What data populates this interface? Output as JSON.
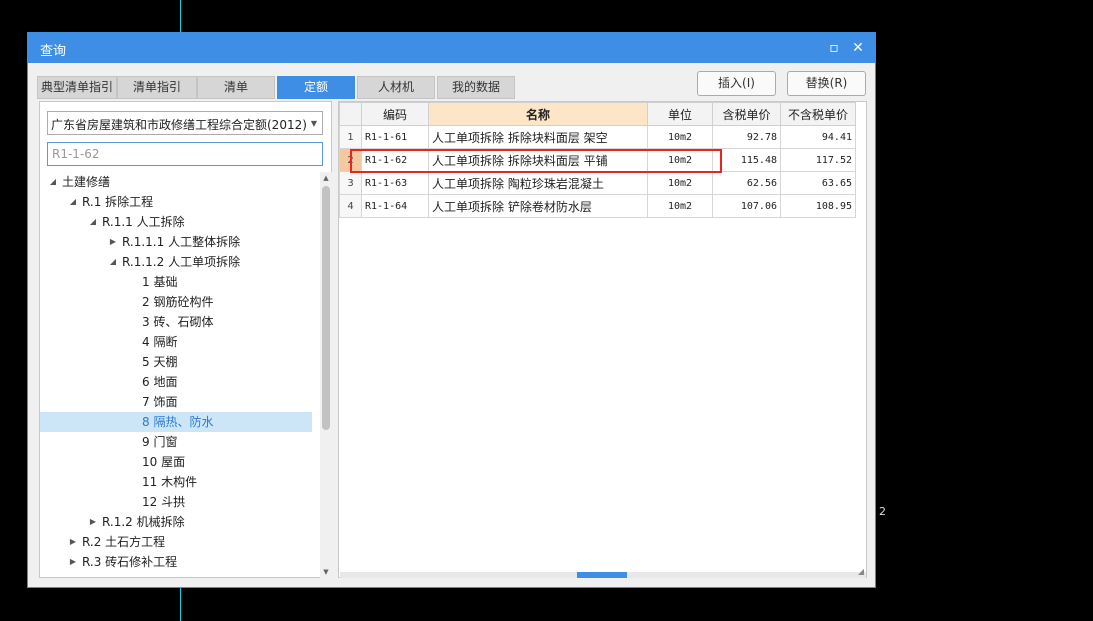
{
  "window": {
    "title": "查询",
    "maximize_icon": "maximize-icon",
    "close_icon": "close-icon"
  },
  "tabs": [
    {
      "label": "典型清单指引",
      "active": false
    },
    {
      "label": "清单指引",
      "active": false
    },
    {
      "label": "清单",
      "active": false
    },
    {
      "label": "定额",
      "active": true
    },
    {
      "label": "人材机",
      "active": false
    },
    {
      "label": "我的数据",
      "active": false
    }
  ],
  "actions": {
    "insert_label": "插入(I)",
    "replace_label": "替换(R)"
  },
  "left": {
    "library_selected": "广东省房屋建筑和市政修缮工程综合定额(2012)",
    "search_value": "R1-1-62",
    "tree": [
      {
        "label": "土建修缮",
        "level": 0,
        "state": "expanded"
      },
      {
        "label": "R.1 拆除工程",
        "level": 1,
        "state": "expanded"
      },
      {
        "label": "R.1.1 人工拆除",
        "level": 2,
        "state": "expanded"
      },
      {
        "label": "R.1.1.1 人工整体拆除",
        "level": 3,
        "state": "collapsed"
      },
      {
        "label": "R.1.1.2 人工单项拆除",
        "level": 3,
        "state": "expanded"
      },
      {
        "label": "1 基础",
        "level": 4,
        "state": "leaf"
      },
      {
        "label": "2 钢筋砼构件",
        "level": 4,
        "state": "leaf"
      },
      {
        "label": "3 砖、石砌体",
        "level": 4,
        "state": "leaf"
      },
      {
        "label": "4 隔断",
        "level": 4,
        "state": "leaf"
      },
      {
        "label": "5 天棚",
        "level": 4,
        "state": "leaf"
      },
      {
        "label": "6 地面",
        "level": 4,
        "state": "leaf"
      },
      {
        "label": "7 饰面",
        "level": 4,
        "state": "leaf"
      },
      {
        "label": "8 隔热、防水",
        "level": 4,
        "state": "leaf",
        "selected": true
      },
      {
        "label": "9 门窗",
        "level": 4,
        "state": "leaf"
      },
      {
        "label": "10 屋面",
        "level": 4,
        "state": "leaf"
      },
      {
        "label": "11 木构件",
        "level": 4,
        "state": "leaf"
      },
      {
        "label": "12 斗拱",
        "level": 4,
        "state": "leaf"
      },
      {
        "label": "R.1.2 机械拆除",
        "level": 2,
        "state": "collapsed"
      },
      {
        "label": "R.2 土石方工程",
        "level": 1,
        "state": "collapsed"
      },
      {
        "label": "R.3 砖石修补工程",
        "level": 1,
        "state": "collapsed"
      }
    ]
  },
  "grid": {
    "headers": {
      "code": "编码",
      "name": "名称",
      "unit": "单位",
      "price_tax": "含税单价",
      "price_notax": "不含税单价"
    },
    "rows": [
      {
        "idx": "1",
        "code": "R1-1-61",
        "name": "人工单项拆除 拆除块料面层 架空",
        "unit": "10m2",
        "price_tax": "92.78",
        "price_notax": "94.41"
      },
      {
        "idx": "2",
        "code": "R1-1-62",
        "name": "人工单项拆除 拆除块料面层 平铺",
        "unit": "10m2",
        "price_tax": "115.48",
        "price_notax": "117.52",
        "current": true
      },
      {
        "idx": "3",
        "code": "R1-1-63",
        "name": "人工单项拆除 陶粒珍珠岩混凝土",
        "unit": "10m2",
        "price_tax": "62.56",
        "price_notax": "63.65"
      },
      {
        "idx": "4",
        "code": "R1-1-64",
        "name": "人工单项拆除 铲除卷材防水层",
        "unit": "10m2",
        "price_tax": "107.06",
        "price_notax": "108.95"
      }
    ]
  },
  "background": {
    "side_text": "2"
  }
}
